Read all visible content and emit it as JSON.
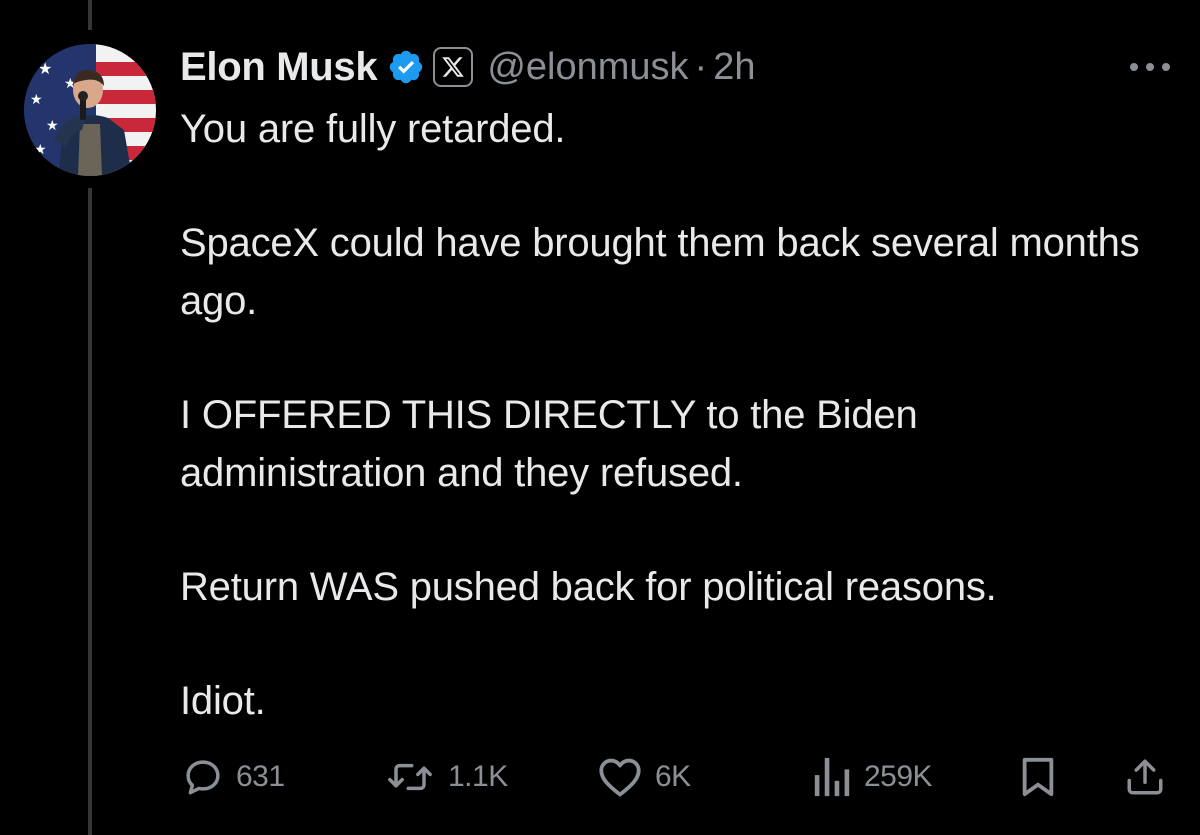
{
  "author": {
    "name": "Elon Musk",
    "handle": "@elonmusk",
    "separator": "·",
    "time": "2h",
    "avatar_icon": "elon-musk-avatar",
    "verified_icon": "verified-badge-icon",
    "affiliation_icon": "x-logo-icon"
  },
  "tweet": {
    "paragraphs": [
      "You are fully retarded.",
      "SpaceX could have brought them back several months ago.",
      "I OFFERED THIS DIRECTLY to the Biden administration and they refused.",
      "Return WAS pushed back for political reasons.",
      "Idiot."
    ]
  },
  "actions": {
    "replies": "631",
    "reposts": "1.1K",
    "likes": "6K",
    "views": "259K"
  },
  "colors": {
    "background": "#000000",
    "text": "#e7e9ea",
    "muted": "#8b9096",
    "verified": "#1d9bf0",
    "thread_line": "#333639"
  }
}
